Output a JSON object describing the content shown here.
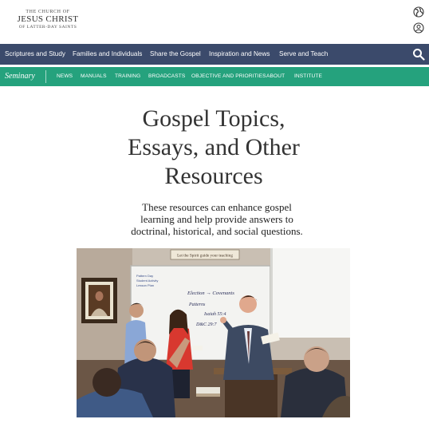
{
  "header": {
    "logo_line1": "THE CHURCH OF",
    "logo_line2": "JESUS CHRIST",
    "logo_line3": "OF LATTER-DAY SAINTS",
    "icons": [
      "globe-icon",
      "user-account-icon"
    ]
  },
  "main_nav": {
    "items": [
      {
        "label": "Scriptures and Study"
      },
      {
        "label": "Families and Individuals"
      },
      {
        "label": "Share the Gospel"
      },
      {
        "label": "Inspiration and News"
      },
      {
        "label": "Serve and Teach"
      }
    ],
    "search_icon": "search-icon",
    "background": "#3b4a6b"
  },
  "sub_nav": {
    "brand": "Seminary",
    "items": [
      {
        "label": "NEWS"
      },
      {
        "label": "MANUALS"
      },
      {
        "label": "TRAINING"
      },
      {
        "label": "BROADCASTS"
      },
      {
        "label": "OBJECTIVE AND PRIORITIES"
      },
      {
        "label": "ABOUT"
      },
      {
        "label": "INSTITUTE"
      }
    ],
    "background": "#25a27d"
  },
  "page": {
    "title_lines": [
      "Gospel Topics,",
      "Essays, and Other",
      "Resources"
    ],
    "description_lines": [
      "These resources can enhance gospel",
      "learning and help provide answers to",
      "doctrinal, historical, and social questions."
    ],
    "photo_sign": "Let the Spirit guide your teaching",
    "photo_board_text": [
      "Election → Covenants",
      "Patterns",
      "Isaiah 55:4",
      "D&C 29:7"
    ]
  }
}
